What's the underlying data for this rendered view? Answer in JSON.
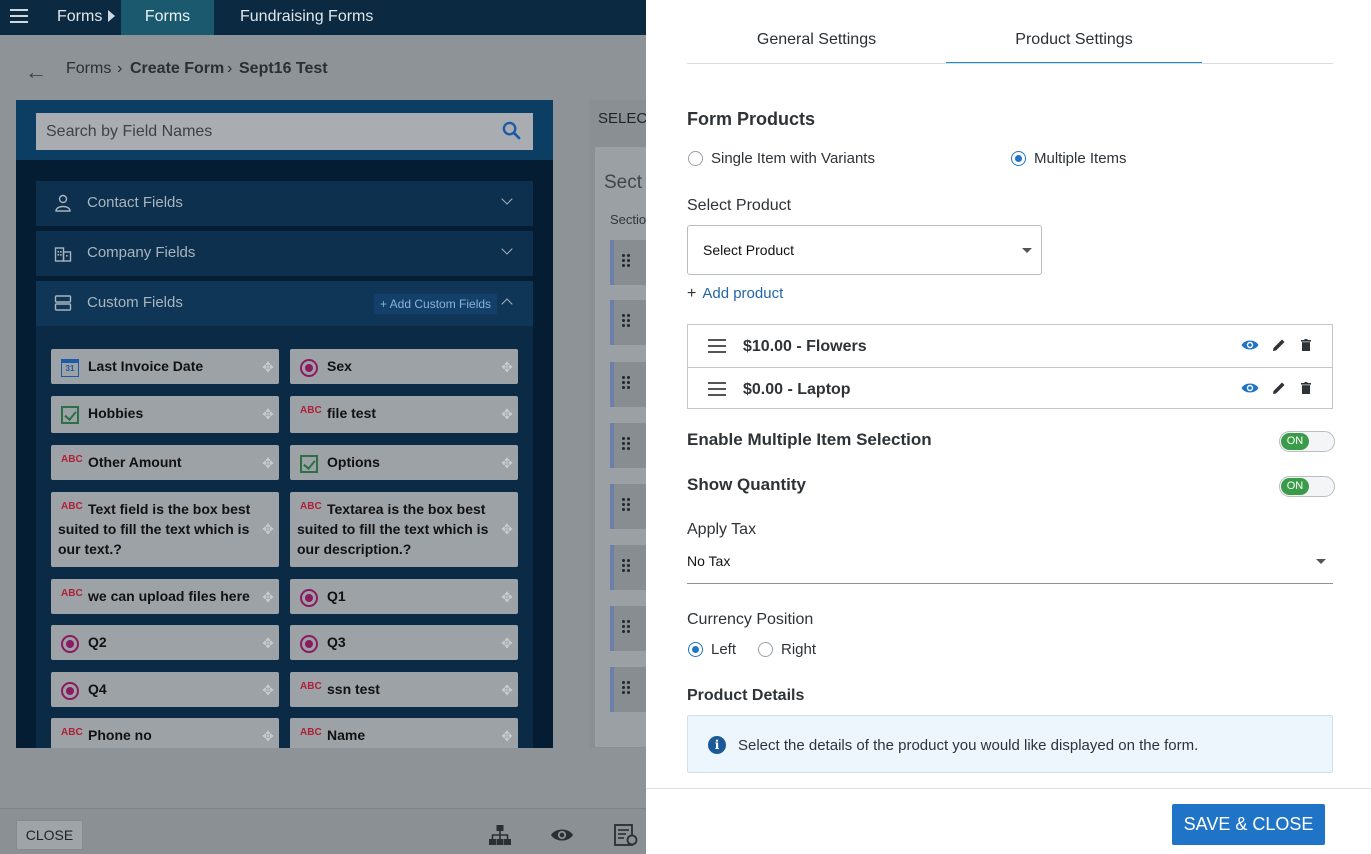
{
  "topbar": {
    "menu_icon": "hamburger-icon",
    "forms_label": "Forms",
    "active_tab": "Forms",
    "fundraising_tab": "Fundraising Forms"
  },
  "breadcrumb": {
    "back": "←",
    "item1": "Forms",
    "sep": "›",
    "item2": "Create Form",
    "item3": "Sept16 Test"
  },
  "left_panel": {
    "search_placeholder": "Search by Field Names",
    "accordions": [
      {
        "label": "Contact Fields",
        "icon": "person-icon"
      },
      {
        "label": "Company Fields",
        "icon": "building-icon"
      },
      {
        "label": "Custom Fields",
        "icon": "fields-icon",
        "add_label": "+ Add Custom Fields"
      }
    ],
    "fields": [
      {
        "label": "Last Invoice Date",
        "icon": "calendar-icon",
        "cal": "31"
      },
      {
        "label": "Sex",
        "icon": "radio-icon"
      },
      {
        "label": "Hobbies",
        "icon": "checkbox-icon"
      },
      {
        "label": "file test",
        "icon": "text-icon",
        "abc": "ABC"
      },
      {
        "label": "Other Amount",
        "icon": "text-icon",
        "abc": "ABC"
      },
      {
        "label": "Options",
        "icon": "checkbox-icon"
      },
      {
        "label": "Text field is the box best suited to fill the text which is our text.?",
        "icon": "text-icon",
        "abc": "ABC"
      },
      {
        "label": "Textarea is the box best suited to fill the text which is our description.?",
        "icon": "text-icon",
        "abc": "ABC"
      },
      {
        "label": "we can upload files here",
        "icon": "text-icon",
        "abc": "ABC"
      },
      {
        "label": "Q1",
        "icon": "radio-icon"
      },
      {
        "label": "Q2",
        "icon": "radio-icon"
      },
      {
        "label": "Q3",
        "icon": "radio-icon"
      },
      {
        "label": "Q4",
        "icon": "radio-icon"
      },
      {
        "label": "ssn test",
        "icon": "text-icon",
        "abc": "ABC"
      },
      {
        "label": "Phone no",
        "icon": "text-icon",
        "abc": "ABC"
      },
      {
        "label": "Name",
        "icon": "text-icon",
        "abc": "ABC"
      }
    ],
    "move_glyph": "✥"
  },
  "mid": {
    "select_label": "SELEC",
    "section_title": "Sect",
    "section_sub": "Sectio"
  },
  "bottombar": {
    "close_label": "CLOSE",
    "icons": [
      "hierarchy-icon",
      "eye-icon",
      "report-icon"
    ]
  },
  "drawer": {
    "tabs": {
      "general": "General Settings",
      "product": "Product Settings"
    },
    "form_products_title": "Form Products",
    "product_mode": {
      "option1": "Single Item with Variants",
      "option2": "Multiple Items",
      "selected": "Multiple Items"
    },
    "select_product_label": "Select Product",
    "select_product_value": "Select Product",
    "add_product": {
      "plus": "+",
      "label": "Add product"
    },
    "products": [
      {
        "name": "$10.00 - Flowers"
      },
      {
        "name": "$0.00 - Laptop"
      }
    ],
    "enable_multiple": {
      "label": "Enable Multiple Item Selection",
      "state": "ON"
    },
    "show_quantity": {
      "label": "Show Quantity",
      "state": "ON"
    },
    "apply_tax": {
      "label": "Apply Tax",
      "value": "No Tax"
    },
    "currency_position": {
      "label": "Currency Position",
      "left": "Left",
      "right": "Right",
      "selected": "Left"
    },
    "product_details": {
      "label": "Product Details",
      "info_icon": "i",
      "info_text": "Select the details of the product you would like displayed on the form."
    },
    "save_close": "SAVE & CLOSE"
  },
  "colors": {
    "accent": "#1f74c7",
    "toggle_on": "#3a9c48",
    "tab_underline": "#1f8ecb"
  }
}
